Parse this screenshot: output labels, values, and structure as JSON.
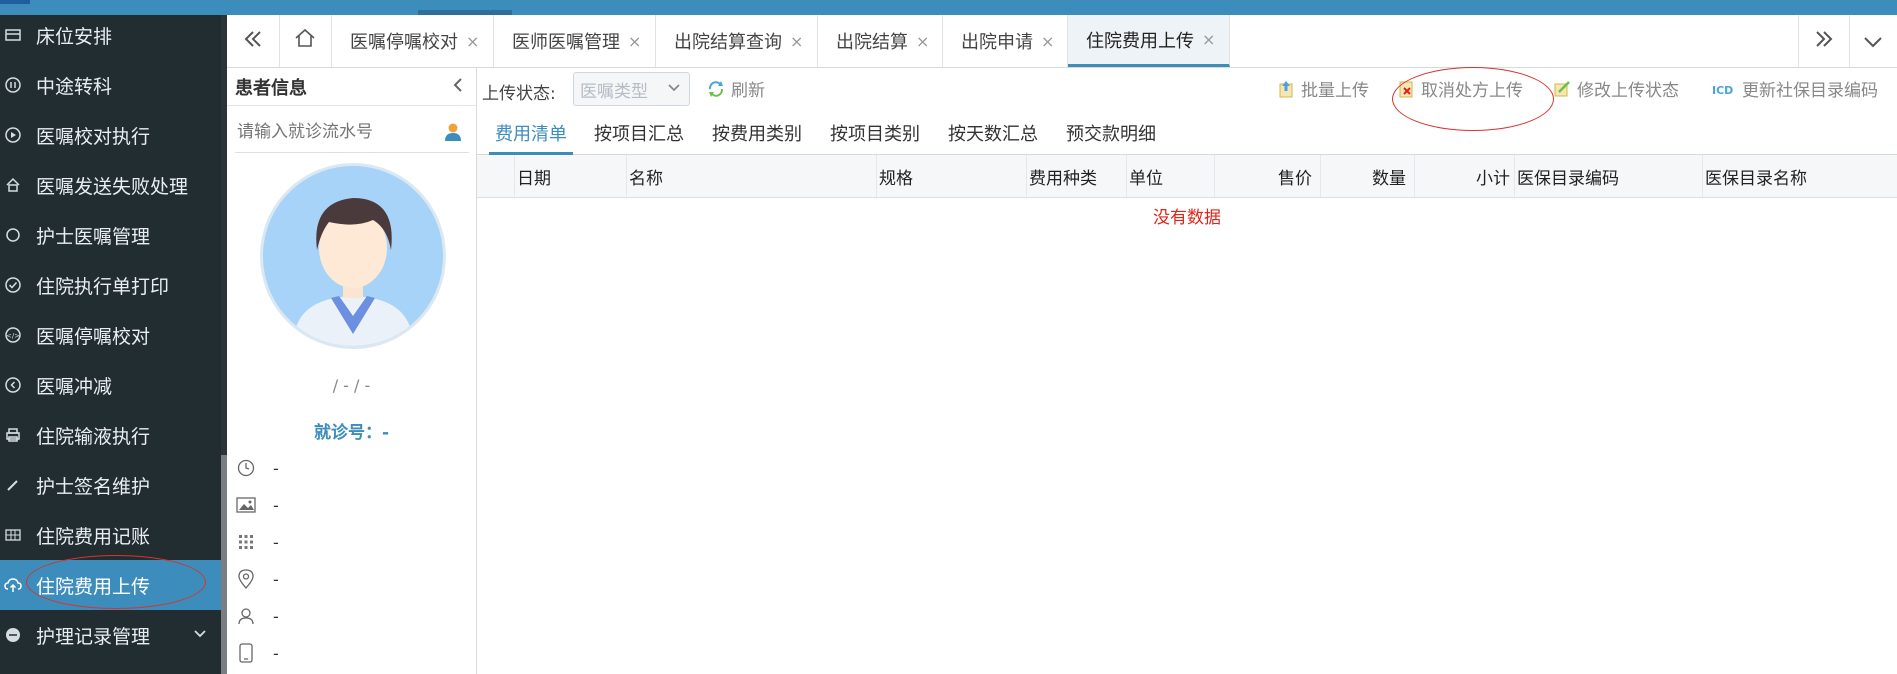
{
  "sidebar": {
    "items": [
      {
        "label": "床位安排",
        "icon": "bed-icon"
      },
      {
        "label": "中途转科",
        "icon": "pause-circle-icon"
      },
      {
        "label": "医嘱校对执行",
        "icon": "play-circle-icon"
      },
      {
        "label": "医嘱发送失败处理",
        "icon": "home-icon"
      },
      {
        "label": "护士医嘱管理",
        "icon": "circle-icon"
      },
      {
        "label": "住院执行单打印",
        "icon": "check-circle-icon"
      },
      {
        "label": "医嘱停嘱校对",
        "icon": "code-circle-icon"
      },
      {
        "label": "医嘱冲减",
        "icon": "back-circle-icon"
      },
      {
        "label": "住院输液执行",
        "icon": "print-icon"
      },
      {
        "label": "护士签名维护",
        "icon": "pen-icon"
      },
      {
        "label": "住院费用记账",
        "icon": "table-icon"
      },
      {
        "label": "住院费用上传",
        "icon": "cloud-upload-icon"
      },
      {
        "label": "护理记录管理",
        "icon": "record-icon"
      }
    ],
    "active_index": 11
  },
  "tabs": [
    {
      "label": "医嘱停嘱校对"
    },
    {
      "label": "医师医嘱管理"
    },
    {
      "label": "出院结算查询"
    },
    {
      "label": "出院结算"
    },
    {
      "label": "出院申请"
    },
    {
      "label": "住院费用上传"
    }
  ],
  "tab_close": "×",
  "patient": {
    "title": "患者信息",
    "search_placeholder": "请输入就诊流水号",
    "name_line": "/ - / -",
    "visit_label": "就诊号：-",
    "rows": [
      {
        "icon": "clock-icon",
        "value": "-"
      },
      {
        "icon": "image-icon",
        "value": "-"
      },
      {
        "icon": "grid-icon",
        "value": "-"
      },
      {
        "icon": "location-icon",
        "value": "-"
      },
      {
        "icon": "person-icon",
        "value": "-"
      },
      {
        "icon": "phone-icon",
        "value": "-"
      }
    ]
  },
  "toolbar": {
    "status_label": "上传状态:",
    "type_placeholder": "医嘱类型",
    "refresh": "刷新",
    "batch_upload": "批量上传",
    "cancel_upload": "取消处方上传",
    "modify_status": "修改上传状态",
    "update_code": "更新社保目录编码"
  },
  "subtabs": [
    "费用清单",
    "按项目汇总",
    "按费用类别",
    "按项目类别",
    "按天数汇总",
    "预交款明细"
  ],
  "table": {
    "columns": [
      "日期",
      "名称",
      "规格",
      "费用种类",
      "单位",
      "售价",
      "数量",
      "小计",
      "医保目录编码",
      "医保目录名称"
    ],
    "empty_text": "没有数据"
  },
  "colors": {
    "sidebar_bg": "#222d32",
    "accent": "#3c8dbc",
    "annotation": "#d9332e",
    "empty_text": "#e2231a"
  }
}
